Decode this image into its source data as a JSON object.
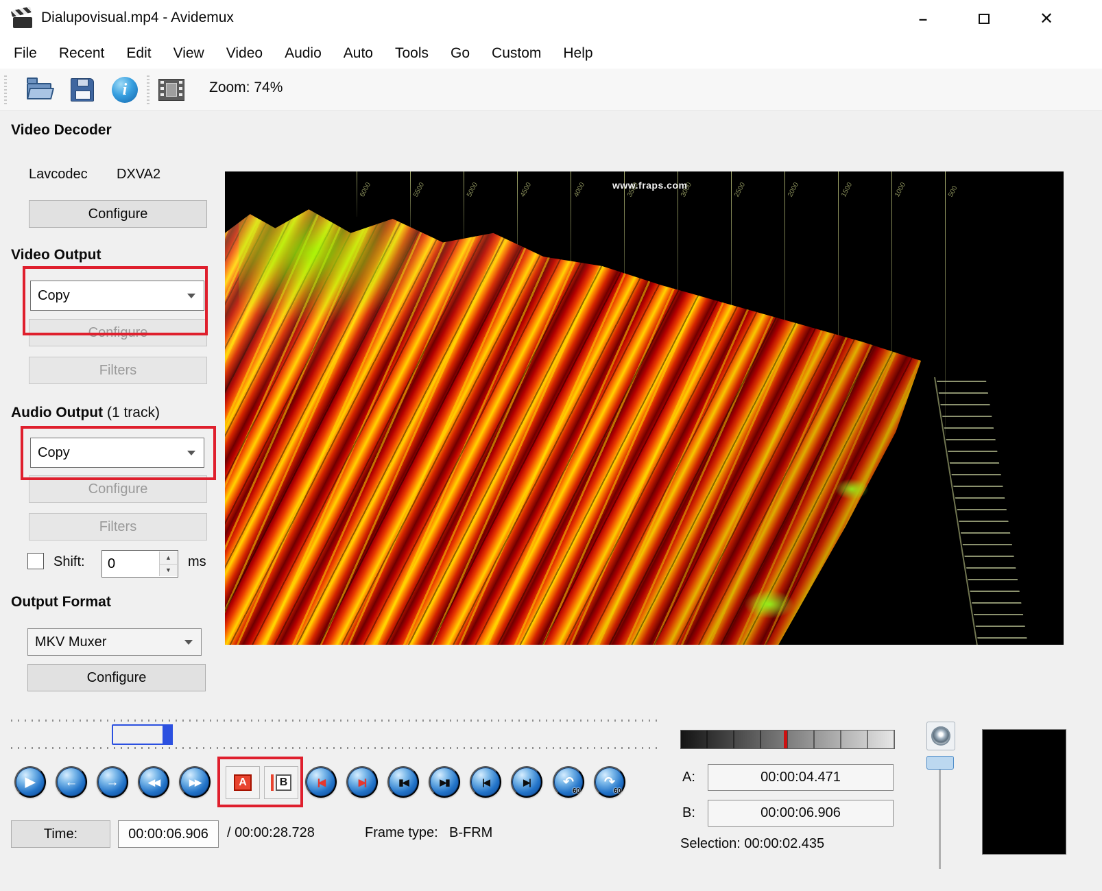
{
  "window": {
    "title": "Dialupovisual.mp4 - Avidemux",
    "min_glyph": "–",
    "close_glyph": "✕"
  },
  "menu": {
    "items": [
      "File",
      "Recent",
      "Edit",
      "View",
      "Video",
      "Audio",
      "Auto",
      "Tools",
      "Go",
      "Custom",
      "Help"
    ]
  },
  "toolbar": {
    "zoom": "Zoom: 74%",
    "info_glyph": "i",
    "icons": [
      "open-file-icon",
      "save-file-icon",
      "information-icon",
      "video-properties-icon"
    ]
  },
  "sidebar": {
    "video_decoder": {
      "heading": "Video Decoder",
      "decoder_name": "Lavcodec",
      "accel_name": "DXVA2",
      "configure": "Configure"
    },
    "video_output": {
      "heading": "Video Output",
      "codec": "Copy",
      "configure": "Configure",
      "filters": "Filters"
    },
    "audio_output": {
      "heading": "Audio Output",
      "track_note": "(1 track)",
      "codec": "Copy",
      "configure": "Configure",
      "filters": "Filters",
      "shift_label": "Shift:",
      "shift_value": "0",
      "shift_unit": "ms",
      "spin_up": "▲",
      "spin_down": "▼"
    },
    "output_format": {
      "heading": "Output Format",
      "muxer": "MKV Muxer",
      "configure": "Configure"
    }
  },
  "video": {
    "watermark": "www.fraps.com",
    "grid_labels": [
      "6000",
      "5500",
      "5000",
      "4500",
      "4000",
      "3500",
      "3000",
      "2500",
      "2000",
      "1500",
      "1000",
      "500"
    ]
  },
  "transport": {
    "buttons": [
      {
        "name": "play",
        "glyph": "▶"
      },
      {
        "name": "step-back",
        "glyph": "←"
      },
      {
        "name": "step-forward",
        "glyph": "→"
      },
      {
        "name": "fast-backward",
        "glyph": "◀◀"
      },
      {
        "name": "fast-forward",
        "glyph": "▶▶"
      },
      {
        "name": "previous-keyframe",
        "glyph": "|◀"
      },
      {
        "name": "next-keyframe",
        "glyph": "▶|"
      },
      {
        "name": "previous-black-frame",
        "glyph": "▮◀"
      },
      {
        "name": "next-black-frame",
        "glyph": "▶▮"
      },
      {
        "name": "first-frame",
        "glyph": "|◀"
      },
      {
        "name": "last-frame",
        "glyph": "▶|"
      },
      {
        "name": "back-60-seconds",
        "glyph": "↶",
        "badge": "60"
      },
      {
        "name": "forward-60-seconds",
        "glyph": "↷",
        "badge": "60"
      }
    ],
    "marker_a_label": "A",
    "marker_b_label": "B"
  },
  "status": {
    "time_button": "Time:",
    "current_time": "00:00:06.906",
    "duration": "/ 00:00:28.728",
    "frame_type_label": "Frame type:",
    "frame_type_value": "B-FRM"
  },
  "selection": {
    "a_label": "A:",
    "a_time": "00:00:04.471",
    "b_label": "B:",
    "b_time": "00:00:06.906",
    "selection_text": "Selection: 00:00:02.435"
  },
  "colors": {
    "highlight_red": "#df1f2d",
    "accent_blue": "#2b50e0"
  }
}
